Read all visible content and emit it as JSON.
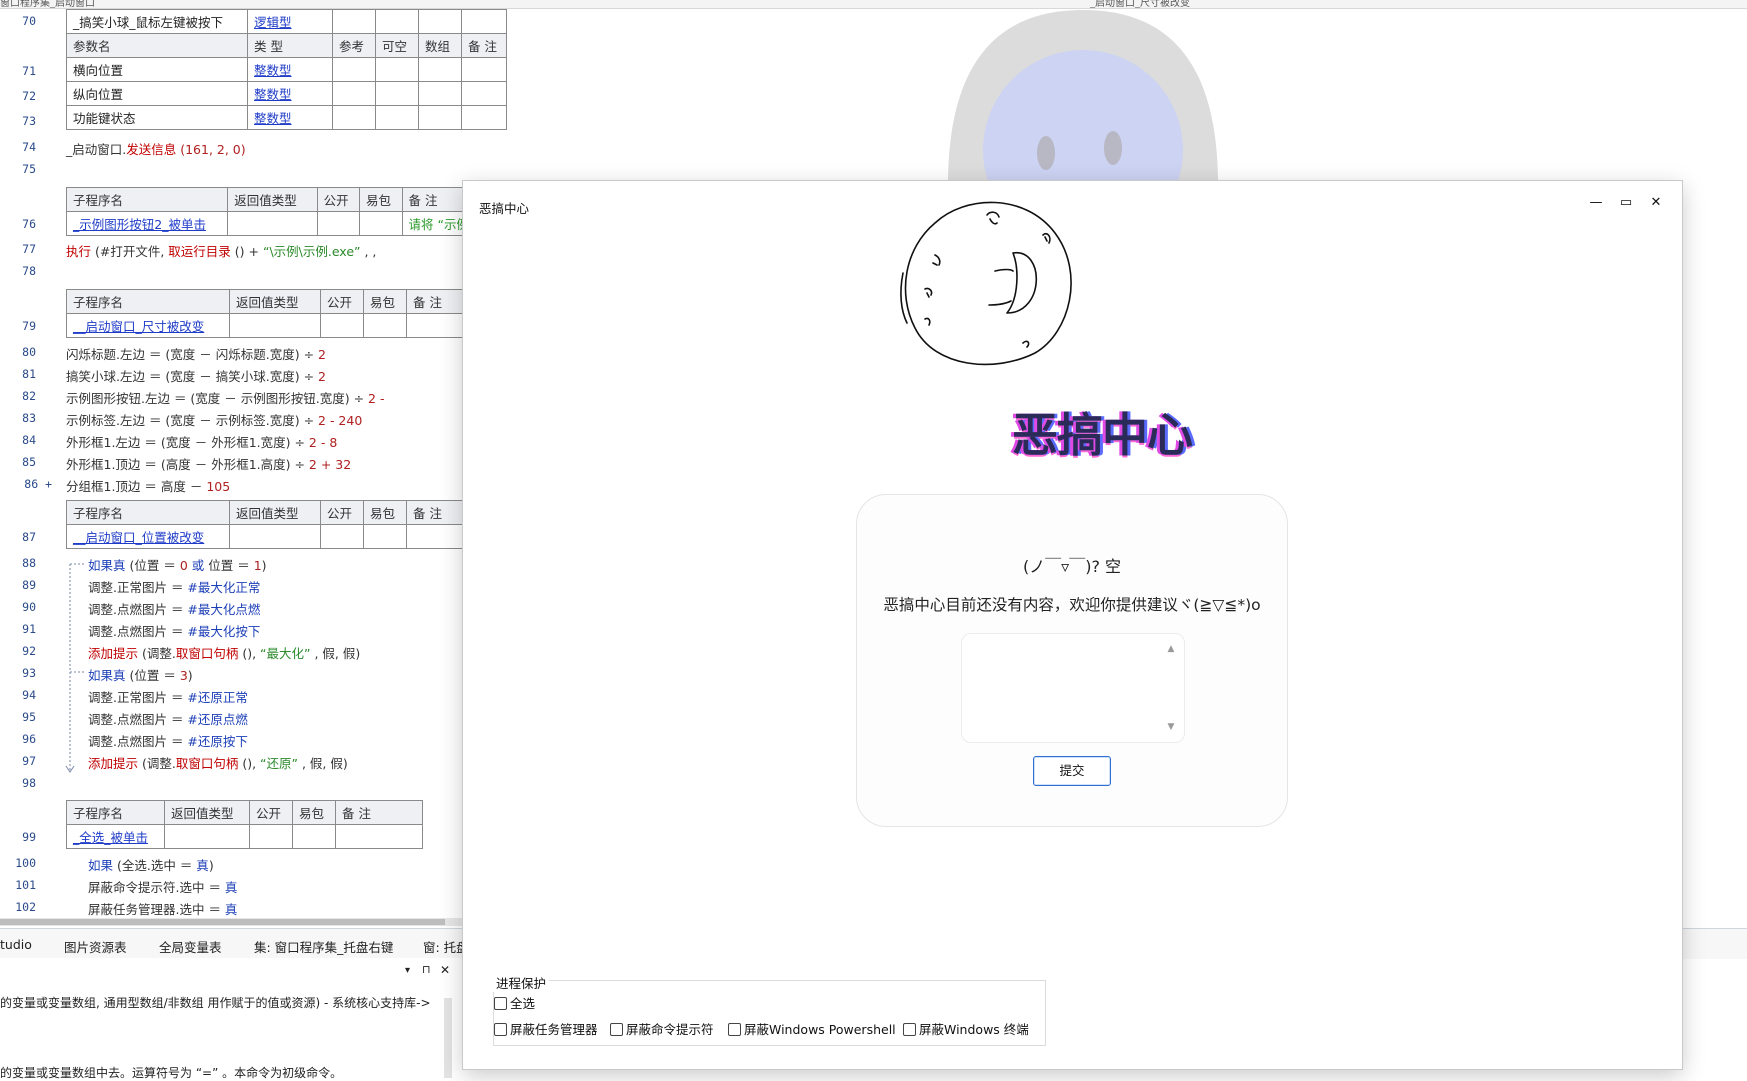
{
  "ide": {
    "top_tabs": [
      "窗口程序集_启动窗口",
      "_启动窗口_尺寸被改变"
    ],
    "event1": {
      "line": "70",
      "name": "_搞笑小球_鼠标左键被按下",
      "type": "逻辑型",
      "param_header": [
        "参数名",
        "类 型",
        "参考",
        "可空",
        "数组",
        "备 注"
      ],
      "params": [
        {
          "line": "71",
          "name": "横向位置",
          "type": "整数型"
        },
        {
          "line": "72",
          "name": "纵向位置",
          "type": "整数型"
        },
        {
          "line": "73",
          "name": "功能键状态",
          "type": "整数型"
        }
      ]
    },
    "sub_header": [
      "子程序名",
      "返回值类型",
      "公开",
      "易包",
      "备 注"
    ],
    "lines": {
      "l74": "74",
      "l74_obj": "_启动窗口.",
      "l74_fn": "发送信息",
      "l74_args": " (161, 2, 0)",
      "l75": "75",
      "l76": "76",
      "l76_name": "_示例图形按钮2_被单击",
      "l76_note": "请将 “示例",
      "l77": "77",
      "l77_fn": "执行",
      "l77_rest": " (#打开文件, ",
      "l77_fn2": "取运行目录",
      "l77_rest2": " () +  ",
      "l77_str": "“\\示例\\示例.exe”",
      "l77_rest3": " , , ",
      "l78": "78",
      "l79": "79",
      "l79_name": "__启动窗口_尺寸被改变",
      "l80": "80",
      "l80_code": "闪烁标题.左边 ＝ (宽度 － 闪烁标题.宽度) ÷ ",
      "l80_num": "2",
      "l81": "81",
      "l81_code": "搞笑小球.左边 ＝ (宽度 － 搞笑小球.宽度) ÷ ",
      "l81_num": "2",
      "l82": "82",
      "l82_code": "示例图形按钮.左边 ＝ (宽度 － 示例图形按钮.宽度) ÷ ",
      "l82_num": "2 -",
      "l83": "83",
      "l83_code": "示例标签.左边 ＝ (宽度 － 示例标签.宽度) ÷ ",
      "l83_num": "2 - 240",
      "l84": "84",
      "l84_code": "外形框1.左边 ＝ (宽度 － 外形框1.宽度) ÷ ",
      "l84_num": "2 - 8",
      "l85": "85",
      "l85_code": "外形框1.顶边 ＝ (高度 － 外形框1.高度) ÷ ",
      "l85_num": "2 + 32",
      "l86": "86 +",
      "l86_code": "分组框1.顶边 ＝ 高度 － ",
      "l86_num": "105",
      "l87": "87",
      "l87_name": "__启动窗口_位置被改变",
      "l88": "88",
      "l88_kw": "如果真",
      "l88_code": " (位置 ＝ ",
      "l88_n1": "0",
      "l88_kw2": " 或 ",
      "l88_code2": "位置 ＝ ",
      "l88_n2": "1",
      "l88_end": ")",
      "l89": "89",
      "l89_code": "调整.正常图片 ＝ ",
      "l89_const": "#最大化正常",
      "l90": "90",
      "l90_code": "调整.点燃图片 ＝ ",
      "l90_const": "#最大化点燃",
      "l91": "91",
      "l91_code": "调整.点燃图片 ＝ ",
      "l91_const": "#最大化按下",
      "l92": "92",
      "l92_fn": "添加提示",
      "l92_code": " (调整.",
      "l92_fn2": "取窗口句柄",
      "l92_code2": " (),  ",
      "l92_str": "“最大化”",
      "l92_end": " , 假, 假)",
      "l93": "93",
      "l93_kw": "如果真",
      "l93_code": " (位置 ＝ ",
      "l93_n": "3",
      "l93_end": ")",
      "l94": "94",
      "l94_code": "调整.正常图片 ＝ ",
      "l94_const": "#还原正常",
      "l95": "95",
      "l95_code": "调整.点燃图片 ＝ ",
      "l95_const": "#还原点燃",
      "l96": "96",
      "l96_code": "调整.点燃图片 ＝ ",
      "l96_const": "#还原按下",
      "l97": "97",
      "l97_fn": "添加提示",
      "l97_code": " (调整.",
      "l97_fn2": "取窗口句柄",
      "l97_code2": " (),  ",
      "l97_str": "“还原”",
      "l97_end": " , 假, 假)",
      "l98": "98",
      "l99": "99",
      "l99_name": "_全选_被单击",
      "l100": "100",
      "l100_kw": "如果",
      "l100_code": " (全选.选中 ＝ ",
      "l100_val": "真",
      "l100_end": ")",
      "l101": "101",
      "l101_code": "屏蔽命令提示符.选中 ＝ ",
      "l101_val": "真",
      "l102": "102",
      "l102_code": "屏蔽任务管理器.选中 ＝ ",
      "l102_val": "真"
    },
    "bottom_tabs": [
      "tudio",
      "图片资源表",
      "全局变量表",
      "集: 窗口程序集_托盘右键",
      "窗: 托盘"
    ],
    "bottom_text": [
      "的变量或变量数组, 通用型数组/非数组 用作赋于的值或资源)  - 系统核心支持库->",
      "的变量或变量数组中去。运算符号为 “=” 。本命令为初级命令。"
    ],
    "panel_controls": [
      "▾",
      "⊓",
      "✕"
    ]
  },
  "dialog": {
    "title": "恶搞中心",
    "window_buttons": {
      "minimize": "—",
      "maximize": "▭",
      "close": "✕"
    },
    "banner": "恶搞中心",
    "card": {
      "kaomoji": "(ノ￣▿￣)? 空",
      "message": "恶搞中心目前还没有内容，欢迎你提供建议ヾ(≧▽≦*)o",
      "textarea_value": "",
      "submit_label": "提交"
    },
    "protection": {
      "legend": "进程保护",
      "select_all": "全选",
      "options": [
        "屏蔽任务管理器",
        "屏蔽命令提示符",
        "屏蔽Windows Powershell",
        "屏蔽Windows 终端"
      ]
    }
  }
}
